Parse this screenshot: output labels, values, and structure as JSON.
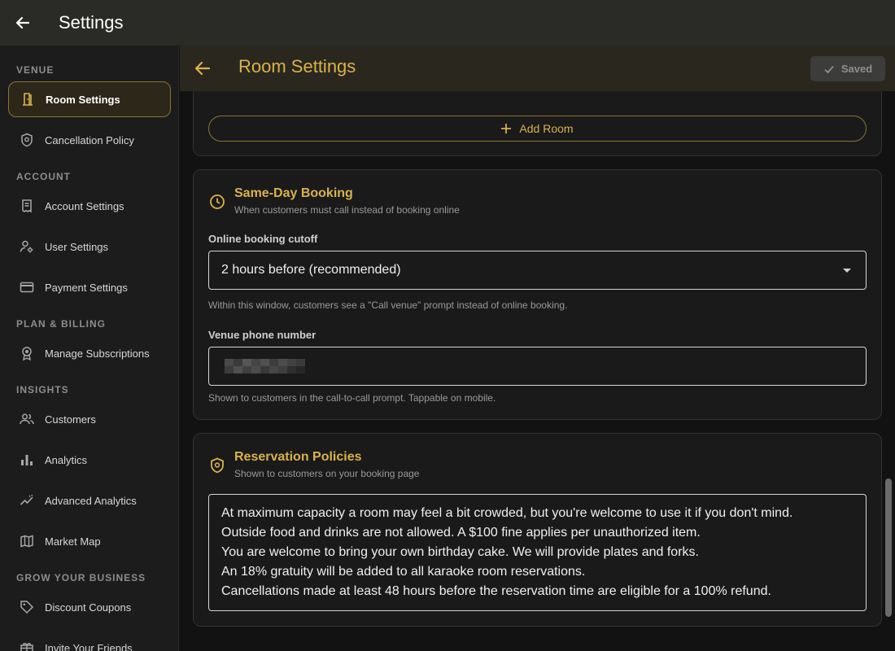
{
  "app": {
    "title": "Settings"
  },
  "colors": {
    "accent": "#d9b24a",
    "active_border": "#8a7535",
    "topbar": "#2a2a26"
  },
  "sidebar": {
    "sections": [
      {
        "title": "VENUE"
      },
      {
        "title": "ACCOUNT"
      },
      {
        "title": "PLAN & BILLING"
      },
      {
        "title": "INSIGHTS"
      },
      {
        "title": "GROW YOUR BUSINESS"
      }
    ],
    "items": [
      {
        "label": "Room Settings",
        "icon": "door-icon",
        "active": true
      },
      {
        "label": "Cancellation Policy",
        "icon": "shield-icon"
      },
      {
        "label": "Account Settings",
        "icon": "receipt-icon"
      },
      {
        "label": "User Settings",
        "icon": "user-gear-icon"
      },
      {
        "label": "Payment Settings",
        "icon": "credit-card-icon"
      },
      {
        "label": "Manage Subscriptions",
        "icon": "badge-icon"
      },
      {
        "label": "Customers",
        "icon": "people-icon"
      },
      {
        "label": "Analytics",
        "icon": "bar-chart-icon"
      },
      {
        "label": "Advanced Analytics",
        "icon": "trend-icon"
      },
      {
        "label": "Market Map",
        "icon": "map-icon"
      },
      {
        "label": "Discount Coupons",
        "icon": "tag-icon"
      },
      {
        "label": "Invite Your Friends",
        "icon": "gift-icon"
      }
    ]
  },
  "main": {
    "title": "Room Settings",
    "saved_label": "Saved",
    "add_room_label": "Add Room",
    "same_day": {
      "title": "Same-Day Booking",
      "subtitle": "When customers must call instead of booking online",
      "cutoff_label": "Online booking cutoff",
      "cutoff_value": "2 hours before (recommended)",
      "cutoff_help": "Within this window, customers see a \"Call venue\" prompt instead of online booking.",
      "phone_label": "Venue phone number",
      "phone_help": "Shown to customers in the call-to-call prompt. Tappable on mobile."
    },
    "policies": {
      "title": "Reservation Policies",
      "subtitle": "Shown to customers on your booking page",
      "lines": [
        "At maximum capacity a room may feel a bit crowded, but you're welcome to use it if you don't mind.",
        "Outside food and drinks are not allowed. A $100 fine applies per unauthorized item.",
        "You are welcome to bring your own birthday cake. We will provide plates and forks.",
        "An 18% gratuity will be added to all karaoke room reservations.",
        "Cancellations made at least 48 hours before the reservation time are eligible for a 100% refund."
      ]
    }
  }
}
